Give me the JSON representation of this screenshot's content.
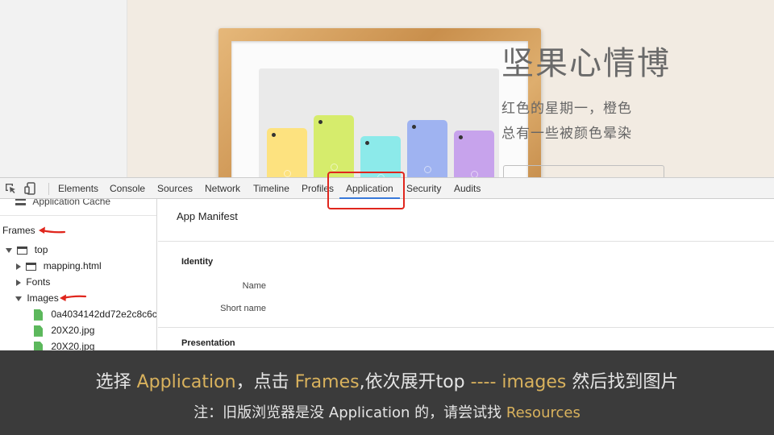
{
  "website": {
    "title": "坚果心情博",
    "line1": "红色的星期一，橙色",
    "line2": "总有一些被颜色晕染",
    "phone_colors": [
      "#fde27f",
      "#d6ec6c",
      "#8ceaea",
      "#9fb3f1",
      "#c7a3ec"
    ]
  },
  "devtools": {
    "tabs": [
      "Elements",
      "Console",
      "Sources",
      "Network",
      "Timeline",
      "Profiles",
      "Application",
      "Security",
      "Audits"
    ],
    "active_tab": "Application",
    "accent_color": "#3879d9",
    "highlight_color": "#e0261d",
    "sidebar": {
      "application_cache": "Application Cache",
      "frames": "Frames",
      "top": "top",
      "mapping": "mapping.html",
      "fonts": "Fonts",
      "images": "Images",
      "image_files": [
        "0a4034142dd72e2c8c6c",
        "20X20.jpg",
        "20X20.jpg"
      ]
    },
    "main": {
      "manifest_title": "App Manifest",
      "identity": "Identity",
      "name_label": "Name",
      "short_name_label": "Short name",
      "presentation": "Presentation"
    }
  },
  "caption": {
    "line1": {
      "p1": "选择 ",
      "h1": "Application",
      "p2": "，点击 ",
      "h2": "Frames",
      "p3": ",依次展开top ",
      "h3": "---- images",
      "p4": " 然后找到图片"
    },
    "line2": {
      "p1": "注：旧版浏览器是没 Application 的，请尝试找 ",
      "h1": "Resources"
    },
    "highlight_color": "#d9b25d"
  }
}
